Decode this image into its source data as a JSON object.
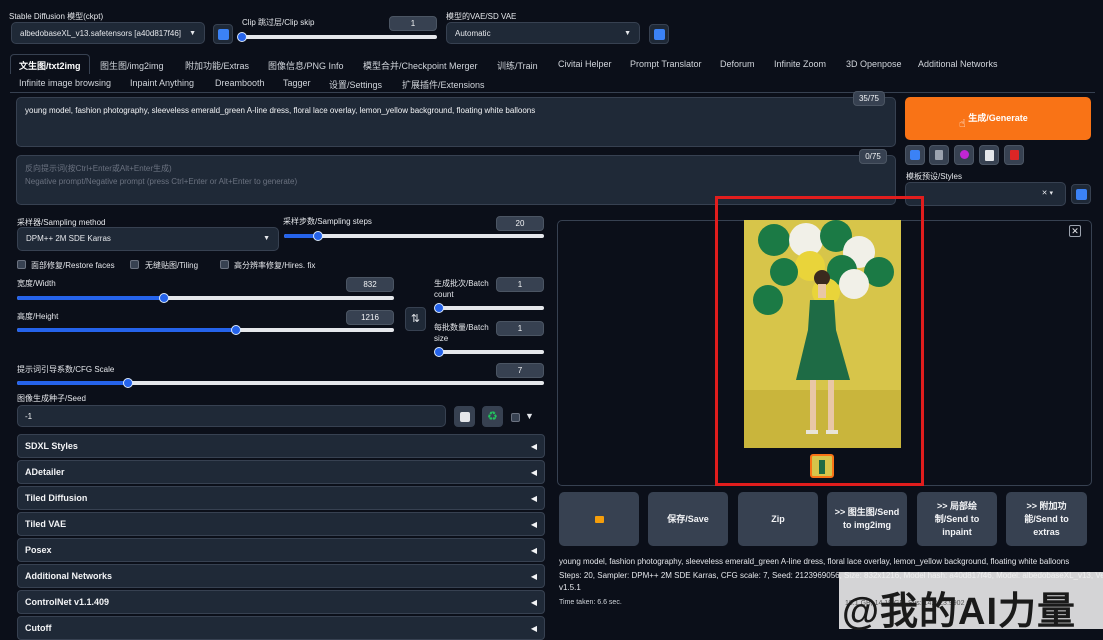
{
  "model": {
    "label": "Stable Diffusion 模型(ckpt)",
    "value": "albedobaseXL_v13.safetensors [a40d817f46]"
  },
  "clip": {
    "label": "Clip 跳过层/Clip skip",
    "value": "1",
    "fraction": 0.0
  },
  "vae": {
    "label": "模型的VAE/SD VAE",
    "value": "Automatic"
  },
  "tabs_row1": [
    "文生图/txt2img",
    "图生图/img2img",
    "附加功能/Extras",
    "图像信息/PNG Info",
    "模型合并/Checkpoint Merger",
    "训练/Train",
    "Civitai Helper",
    "Prompt Translator",
    "Deforum",
    "Infinite Zoom",
    "3D Openpose",
    "Additional Networks"
  ],
  "tabs_row2": [
    "Infinite image browsing",
    "Inpaint Anything",
    "Dreambooth",
    "Tagger",
    "设置/Settings",
    "扩展插件/Extensions"
  ],
  "prompt": {
    "text": "young model, fashion photography, sleeveless emerald_green A-line dress, floral lace overlay, lemon_yellow background, floating white balloons",
    "counter": "35/75"
  },
  "neg_prompt": {
    "placeholder1": "反向提示词(按Ctrl+Enter或Alt+Enter生成)",
    "placeholder2": "Negative prompt/Negative prompt (press Ctrl+Enter or Alt+Enter to generate)",
    "counter": "0/75"
  },
  "generate_label": "生成/Generate",
  "styles_label": "模板预设/Styles",
  "sampler": {
    "label": "采样器/Sampling method",
    "value": "DPM++ 2M SDE Karras"
  },
  "steps": {
    "label": "采样步数/Sampling steps",
    "value": "20",
    "fraction": 0.13
  },
  "checks": {
    "restore": "面部修复/Restore faces",
    "tiling": "无缝贴图/Tiling",
    "hires": "高分辨率修复/Hires. fix"
  },
  "width": {
    "label": "宽度/Width",
    "value": "832",
    "fraction": 0.39
  },
  "height": {
    "label": "高度/Height",
    "value": "1216",
    "fraction": 0.58
  },
  "batch_count": {
    "label1": "生成批次/Batch",
    "label2": "count",
    "value": "1",
    "fraction": 0.0
  },
  "batch_size": {
    "label1": "每批数量/Batch",
    "label2": "size",
    "value": "1",
    "fraction": 0.0
  },
  "cfg": {
    "label": "提示词引导系数/CFG Scale",
    "value": "7",
    "fraction": 0.21
  },
  "seed": {
    "label": "图像生成种子/Seed",
    "value": "-1"
  },
  "accordions": [
    "SDXL Styles",
    "ADetailer",
    "Tiled Diffusion",
    "Tiled VAE",
    "Posex",
    "Additional Networks",
    "ControlNet v1.1.409",
    "Cutoff"
  ],
  "actions": {
    "save": "保存/Save",
    "zip": "Zip",
    "img2img": ">> 图生图/Send to img2img",
    "inpaint": ">> 局部绘制/Send to inpaint",
    "extras": ">> 附加功能/Send to extras"
  },
  "info": {
    "line1": "young model, fashion photography, sleeveless emerald_green A-line dress, floral lace overlay, lemon_yellow background, floating white balloons",
    "line2": "Steps: 20, Sampler: DPM++ 2M SDE Karras, CFG scale: 7, Seed: 2123969056, Size: 832x1216, Model hash: a40d817f46, Model: albedobaseXL_v13, Version:",
    "line3": "v1.5.1",
    "time": "Time taken: 6.6 sec.",
    "vram": "18.1 GB, 14.19 GB, Sys: 14.8/23.9902 GB"
  },
  "watermark": "@我的AI力量",
  "colors": {
    "accent": "#f97316",
    "highlight": "#e11d1d",
    "bg": "#0b0f19"
  }
}
